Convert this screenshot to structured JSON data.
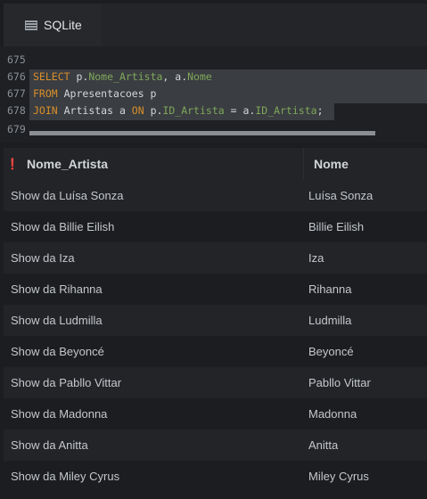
{
  "tab": {
    "label": "SQLite",
    "icon": "database-icon"
  },
  "editor": {
    "lines": [
      {
        "num": "675"
      },
      {
        "num": "676",
        "tokens": [
          {
            "t": "SELECT",
            "c": "kw"
          },
          {
            "t": " p.",
            "c": "txt"
          },
          {
            "t": "Nome_Artista",
            "c": "fld"
          },
          {
            "t": ", a.",
            "c": "txt"
          },
          {
            "t": "Nome",
            "c": "fld"
          }
        ]
      },
      {
        "num": "677",
        "tokens": [
          {
            "t": "FROM",
            "c": "kw"
          },
          {
            "t": " Apresentacoes p",
            "c": "txt"
          }
        ]
      },
      {
        "num": "678",
        "tokens": [
          {
            "t": "JOIN",
            "c": "kw"
          },
          {
            "t": " Artistas a ",
            "c": "txt"
          },
          {
            "t": "ON",
            "c": "kw"
          },
          {
            "t": " p.",
            "c": "txt"
          },
          {
            "t": "ID_Artista",
            "c": "fld"
          },
          {
            "t": " = a.",
            "c": "txt"
          },
          {
            "t": "ID_Artista",
            "c": "fld"
          },
          {
            "t": ";",
            "c": "txt"
          }
        ]
      },
      {
        "num": "679"
      }
    ]
  },
  "results": {
    "columns": [
      "Nome_Artista",
      "Nome"
    ],
    "rows": [
      [
        "Show da Luísa Sonza",
        "Luísa Sonza"
      ],
      [
        "Show da Billie Eilish",
        "Billie Eilish"
      ],
      [
        "Show da Iza",
        "Iza"
      ],
      [
        "Show da Rihanna",
        "Rihanna"
      ],
      [
        "Show da Ludmilla",
        "Ludmilla"
      ],
      [
        "Show da Beyoncé",
        "Beyoncé"
      ],
      [
        "Show da Pabllo Vittar",
        "Pabllo Vittar"
      ],
      [
        "Show da Madonna",
        "Madonna"
      ],
      [
        "Show da Anitta",
        "Anitta"
      ],
      [
        "Show da Miley Cyrus",
        "Miley Cyrus"
      ]
    ]
  }
}
